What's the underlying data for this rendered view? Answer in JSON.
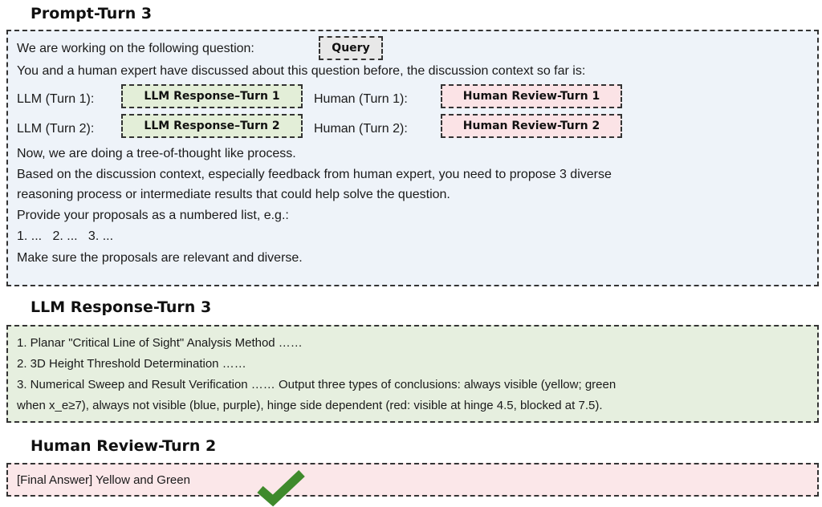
{
  "prompt_section": {
    "title": "Prompt-Turn 3",
    "intro_prefix": "We are working on the following question:",
    "query_tag": "Query",
    "context_line": "You and a human expert have discussed about this question before, the discussion context so far is:",
    "turns": [
      {
        "llm_label": "LLM (Turn 1):",
        "llm_tag": "LLM Response–Turn 1",
        "human_label": "Human (Turn 1):",
        "human_tag": "Human Review-Turn 1"
      },
      {
        "llm_label": "LLM (Turn 2):",
        "llm_tag": "LLM Response–Turn 2",
        "human_label": "Human (Turn 2):",
        "human_tag": "Human Review-Turn 2"
      }
    ],
    "instructions": [
      "Now, we are doing a tree-of-thought like process.",
      "Based on the discussion context, especially feedback from human expert, you need to propose 3 diverse",
      "reasoning process or intermediate results that could help solve the question.",
      "Provide your proposals as a numbered list, e.g.:",
      "1. ...   2. ...   3. ...",
      "Make sure the proposals are relevant and diverse."
    ]
  },
  "llm_section": {
    "title": "LLM Response-Turn 3",
    "lines": [
      "1. Planar \"Critical Line of Sight\" Analysis Method ……",
      "2. 3D Height Threshold Determination ……",
      "3. Numerical Sweep and Result Verification …… Output three types of conclusions: always visible (yellow; green",
      "when x_e≥7), always not visible (blue, purple), hinge side dependent (red: visible at hinge 4.5, blocked at 7.5)."
    ]
  },
  "human_section": {
    "title": "Human Review-Turn 2",
    "answer": "[Final Answer] Yellow and Green"
  },
  "colors": {
    "prompt_bg": "#eef3f9",
    "llm_bg": "#e6efdf",
    "human_bg": "#fbe7e9",
    "check": "#3f8a2c"
  }
}
